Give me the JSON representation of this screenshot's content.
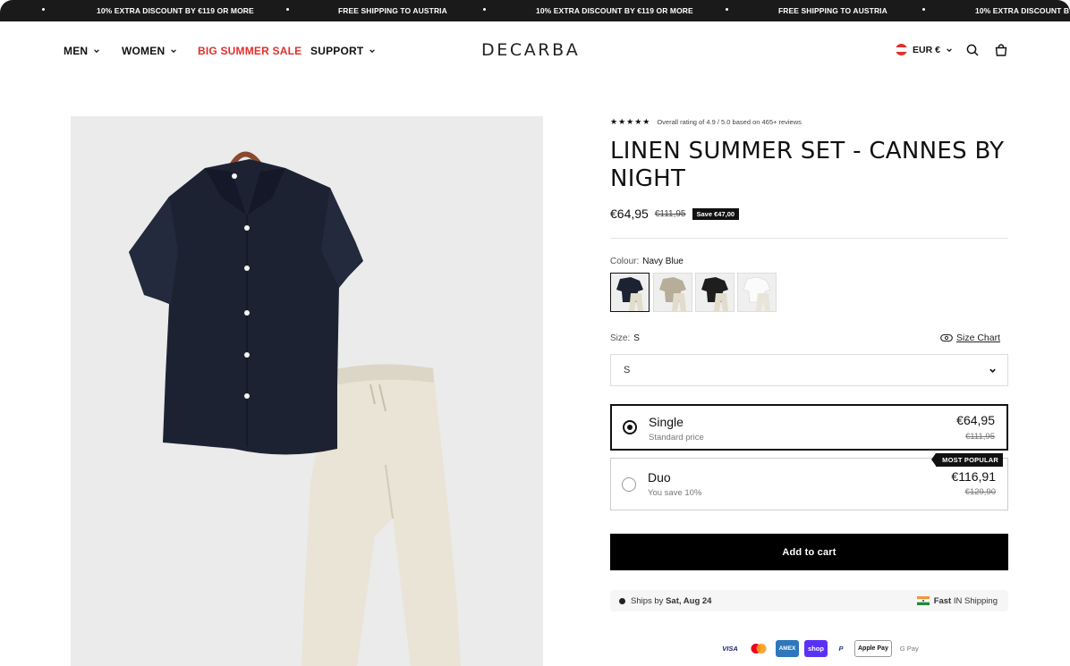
{
  "announcement": {
    "items": [
      "10% EXTRA DISCOUNT BY €119 OR MORE",
      "FREE SHIPPING TO AUSTRIA",
      "10% EXTRA DISCOUNT BY €119 OR MORE",
      "FREE SHIPPING TO AUSTRIA",
      "10% EXTRA DISCOUNT B"
    ]
  },
  "header": {
    "nav": [
      {
        "label": "MEN"
      },
      {
        "label": "WOMEN"
      },
      {
        "label": "BIG SUMMER SALE"
      },
      {
        "label": "SUPPORT"
      }
    ],
    "logo": "DECARBA",
    "currency": "EUR €",
    "icons": [
      "search-icon",
      "cart-icon"
    ]
  },
  "product": {
    "rating_stars": "★★★★★",
    "rating_text": "Overall rating of 4.9 / 5.0 based on 465+ reviews",
    "title": "LINEN SUMMER SET - CANNES BY NIGHT",
    "price": "€64,95",
    "old_price": "€111,95",
    "save_badge": "Save €47,00",
    "colour_label": "Colour:",
    "colour_value": "Navy Blue",
    "size_label": "Size:",
    "size_value": "S",
    "size_chart": "Size Chart",
    "size_select_value": "S",
    "bundles": [
      {
        "title": "Single",
        "subtitle": "Standard price",
        "price": "€64,95",
        "old_price": "€111,95",
        "selected": true
      },
      {
        "title": "Duo",
        "subtitle": "You save 10%",
        "price": "€116,91",
        "old_price": "€129,90",
        "badge": "MOST POPULAR",
        "selected": false
      }
    ],
    "add_to_cart": "Add to cart",
    "ships_prefix": "Ships by ",
    "ships_date": "Sat, Aug 24",
    "fast_shipping_bold": "Fast",
    "fast_shipping_rest": " IN Shipping",
    "payments": [
      "VISA",
      "Mastercard",
      "AMEX",
      "shop",
      "P",
      "Apple Pay",
      "G Pay"
    ]
  },
  "colors": {
    "announcement_bg": "#1a1a1a",
    "sale_red": "#e0302c",
    "shirt_navy": "#1d2233",
    "pants_cream": "#e9e4d6",
    "button_black": "#000000"
  }
}
